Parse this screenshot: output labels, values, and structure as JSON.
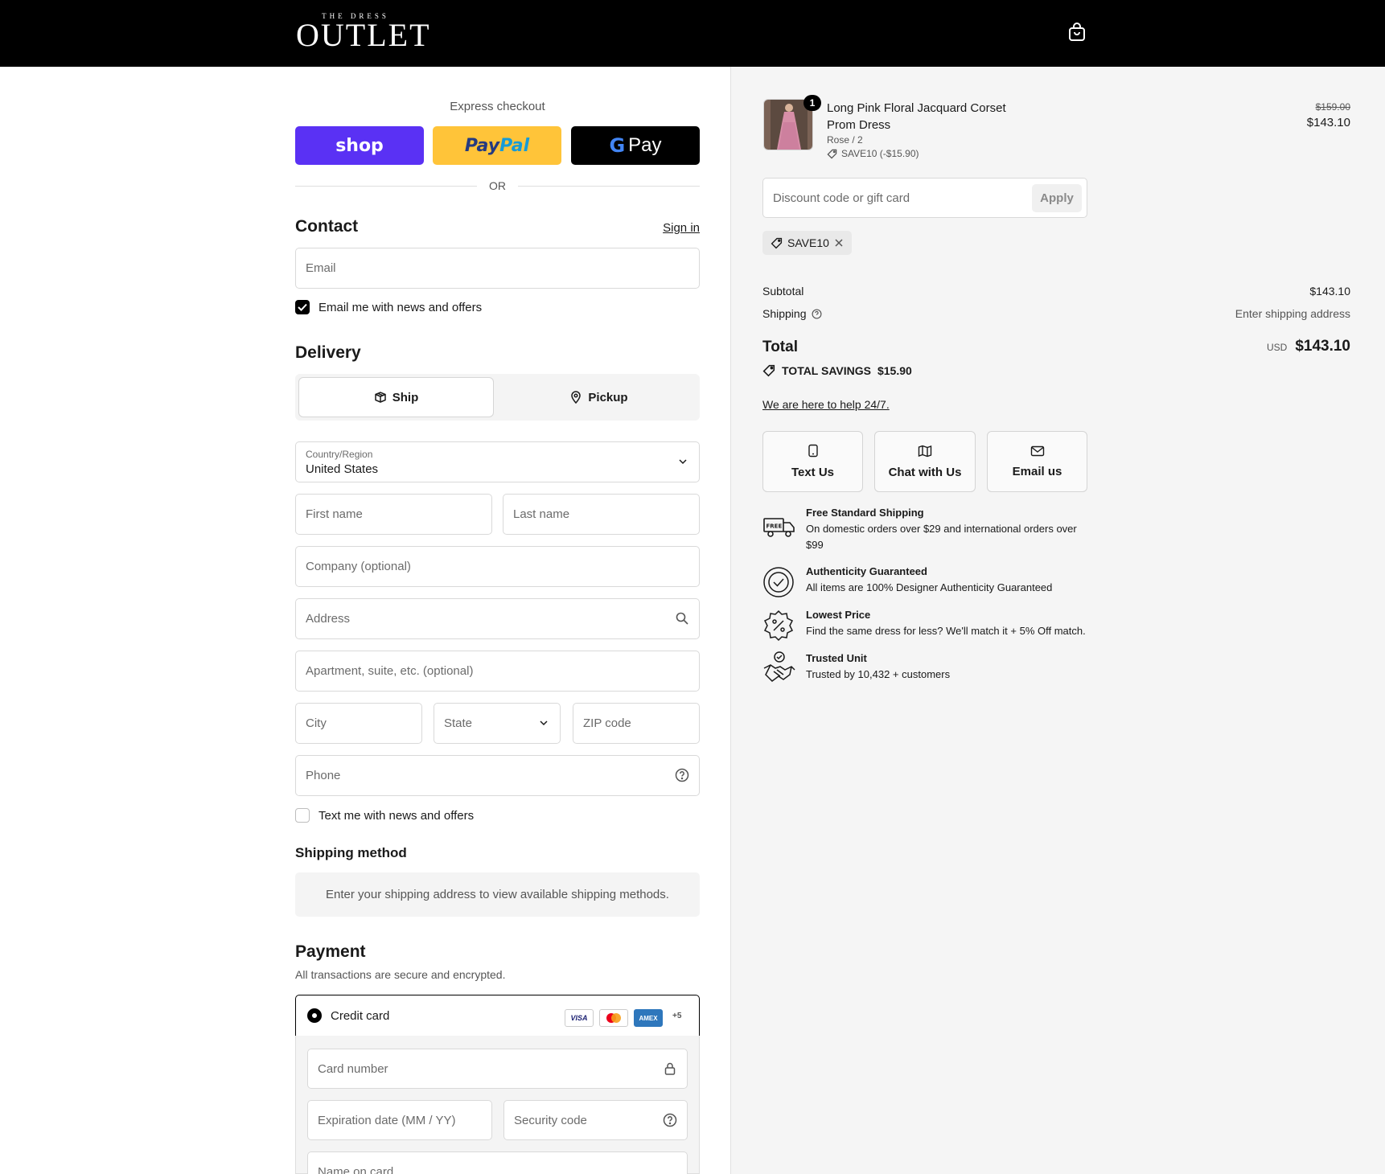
{
  "header": {
    "logo_small": "THE DRESS",
    "logo_big": "OUTLET",
    "cart_icon": "shopping-bag-icon"
  },
  "express": {
    "label": "Express checkout",
    "shop_label": "shop",
    "paypal_label_a": "Pay",
    "paypal_label_b": "Pal",
    "gpay_label": "Pay",
    "divider": "OR"
  },
  "contact": {
    "title": "Contact",
    "sign_in": "Sign in",
    "email_placeholder": "Email",
    "news_label": "Email me with news and offers",
    "news_checked": true
  },
  "delivery": {
    "title": "Delivery",
    "ship_label": "Ship",
    "pickup_label": "Pickup",
    "country_label": "Country/Region",
    "country_value": "United States",
    "first_name": "First name",
    "last_name": "Last name",
    "company": "Company (optional)",
    "address": "Address",
    "apartment": "Apartment, suite, etc. (optional)",
    "city": "City",
    "state": "State",
    "zip": "ZIP code",
    "phone": "Phone",
    "text_label": "Text me with news and offers",
    "text_checked": false
  },
  "shipping_method": {
    "title": "Shipping method",
    "info": "Enter your shipping address to view available shipping methods."
  },
  "payment": {
    "title": "Payment",
    "subtitle": "All transactions are secure and encrypted.",
    "credit_card": "Credit card",
    "visa": "VISA",
    "amex": "AMEX",
    "more": "+5",
    "card_number": "Card number",
    "expiration": "Expiration date (MM / YY)",
    "security_code": "Security code",
    "name_on_card": "Name on card"
  },
  "order": {
    "quantity": "1",
    "product_name": "Long Pink Floral Jacquard Corset Prom Dress",
    "variant": "Rose / 2",
    "discount_line": "SAVE10 (-$15.90)",
    "original_price": "$159.00",
    "price": "$143.10",
    "discount_placeholder": "Discount code or gift card",
    "apply": "Apply",
    "applied_code": "SAVE10",
    "subtotal_label": "Subtotal",
    "subtotal_value": "$143.10",
    "shipping_label": "Shipping",
    "shipping_value": "Enter shipping address",
    "total_label": "Total",
    "currency": "USD",
    "total_value": "$143.10",
    "savings_label": "TOTAL SAVINGS",
    "savings_value": "$15.90"
  },
  "help": {
    "link": "We are here to help 24/7.",
    "text_us": "Text Us",
    "chat_us": "Chat with Us",
    "email_us": "Email us"
  },
  "features": [
    {
      "title": "Free Standard Shipping",
      "desc": "On domestic orders over $29 and international orders over $99",
      "icon": "free-shipping-truck-icon"
    },
    {
      "title": "Authenticity Guaranteed",
      "desc": "All items are 100% Designer Authenticity Guaranteed",
      "icon": "authenticity-badge-icon"
    },
    {
      "title": "Lowest Price",
      "desc": "Find the same dress for less? We'll match it + 5% Off match.",
      "icon": "percent-badge-icon"
    },
    {
      "title": "Trusted Unit",
      "desc": "Trusted by 10,432 + customers",
      "icon": "handshake-icon"
    }
  ],
  "colors": {
    "shop": "#5a31f4",
    "paypal": "#ffc439",
    "gpay": "#000000",
    "header": "#000000",
    "sidebar": "#f5f5f5"
  }
}
